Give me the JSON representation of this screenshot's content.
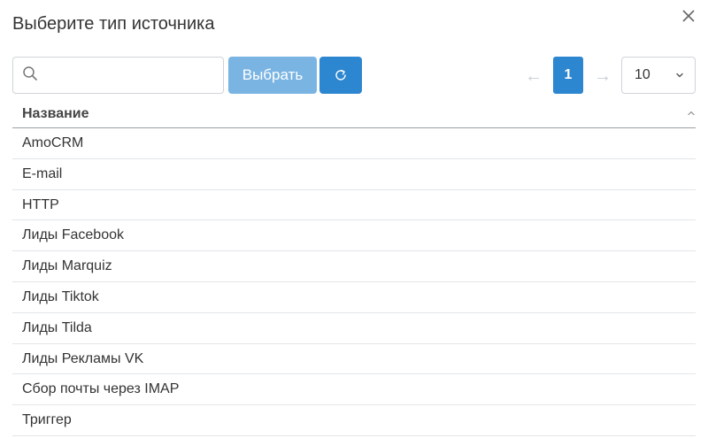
{
  "dialog": {
    "title": "Выберите тип источника",
    "close_icon": "close-icon"
  },
  "toolbar": {
    "search": {
      "value": "",
      "placeholder": "",
      "icon": "search-icon"
    },
    "select_label": "Выбрать",
    "refresh_icon": "refresh-icon",
    "colors": {
      "select_button": "#7ab4e3",
      "primary": "#2d86d0"
    }
  },
  "pagination": {
    "prev_symbol": "←",
    "current_page": "1",
    "next_symbol": "→",
    "page_size": "10"
  },
  "table": {
    "column_header": "Название",
    "sort_icon": "chevron-up-icon",
    "rows": [
      "AmoCRM",
      "E-mail",
      "HTTP",
      "Лиды Facebook",
      "Лиды Marquiz",
      "Лиды Tiktok",
      "Лиды Tilda",
      "Лиды Рекламы VK",
      "Сбор почты через IMAP",
      "Триггер"
    ]
  }
}
